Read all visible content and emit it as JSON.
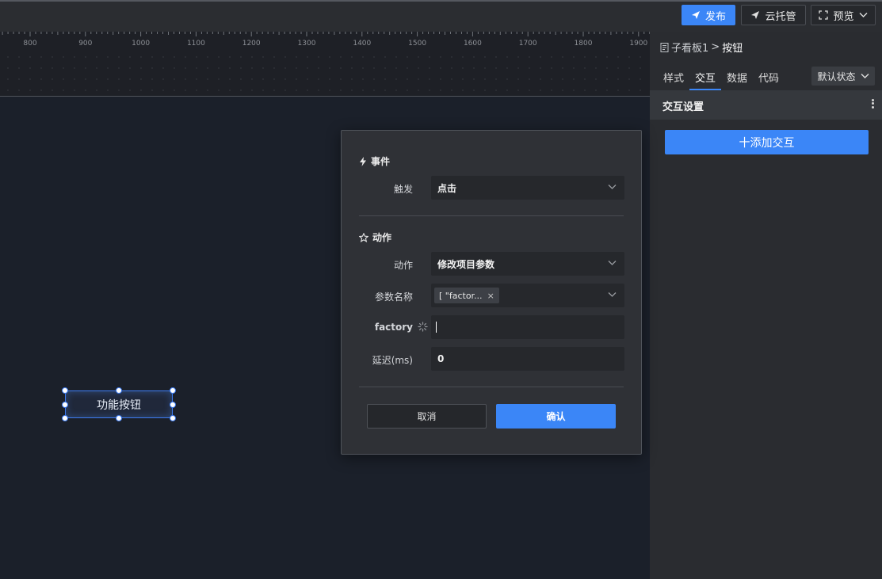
{
  "toolbar": {
    "publish_label": "发布",
    "cloud_label": "云托管",
    "preview_label": "预览"
  },
  "ruler": {
    "ticks": [
      "800",
      "900",
      "1000",
      "1100",
      "1200",
      "1300",
      "1400",
      "1500",
      "1600",
      "1700",
      "1800",
      "1900"
    ]
  },
  "canvas": {
    "widget_label": "功能按钮"
  },
  "panel": {
    "breadcrumb": {
      "parent": "子看板1",
      "separator": ">",
      "current": "按钮"
    },
    "tabs": [
      {
        "label": "样式"
      },
      {
        "label": "交互"
      },
      {
        "label": "数据"
      },
      {
        "label": "代码"
      }
    ],
    "state_select": "默认状态",
    "section_title": "交互设置",
    "add_button": "十添加交互"
  },
  "modal": {
    "event_section": "事件",
    "trigger_label": "触发",
    "trigger_value": "点击",
    "action_section": "动作",
    "action_label": "动作",
    "action_value": "修改项目参数",
    "param_name_label": "参数名称",
    "param_tag": "[ \"factor...",
    "factory_label": "factory",
    "factory_value": "",
    "delay_label": "延迟(ms)",
    "delay_value": "0",
    "cancel_label": "取消",
    "confirm_label": "确认"
  },
  "colors": {
    "accent": "#3b86f7",
    "panel_bg": "#2a2c30",
    "canvas_bg": "#1b202a",
    "modal_bg": "#2f3136"
  }
}
